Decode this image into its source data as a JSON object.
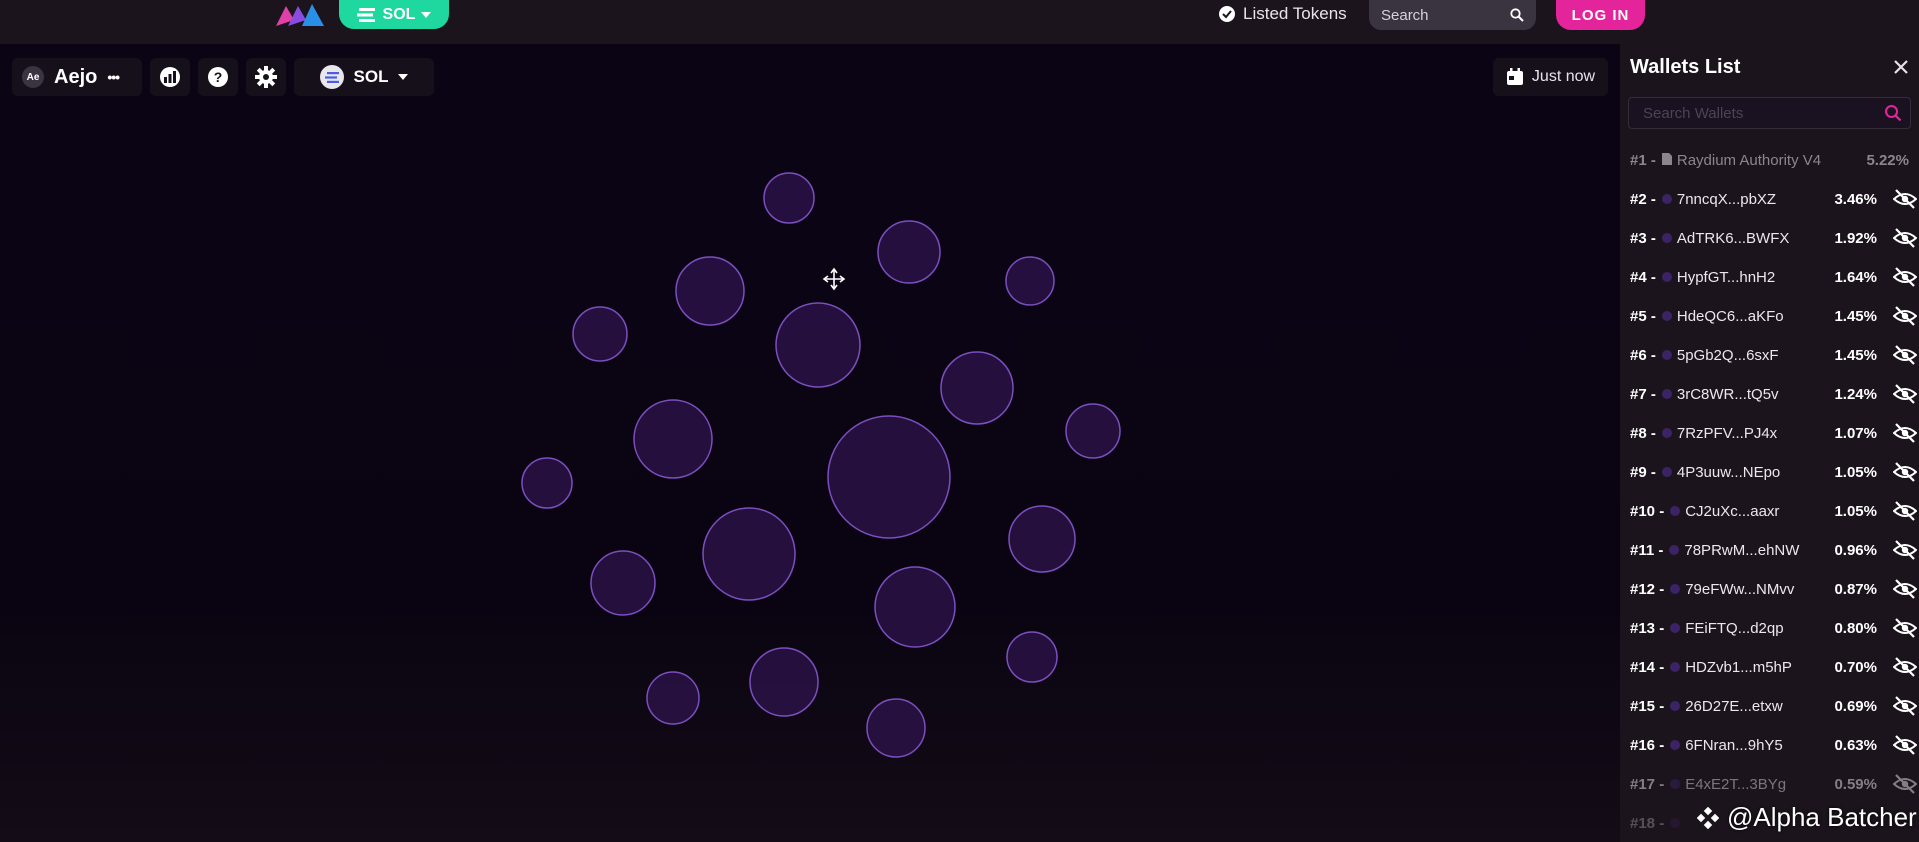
{
  "header": {
    "chain": "SOL",
    "listed_tokens": "Listed Tokens",
    "search_placeholder": "Search",
    "login": "LOG IN"
  },
  "toolbar": {
    "project_initials": "Ae",
    "project_name": "Aejo",
    "more": "•••",
    "currency": "SOL",
    "time": "Just now"
  },
  "wallets": {
    "title": "Wallets List",
    "search_placeholder": "Search Wallets",
    "items": [
      {
        "rank": "#1 -",
        "name": "Raydium Authority V4",
        "pct": "5.22%"
      },
      {
        "rank": "#2 -",
        "name": "7nncqX...pbXZ",
        "pct": "3.46%"
      },
      {
        "rank": "#3 -",
        "name": "AdTRK6...BWFX",
        "pct": "1.92%"
      },
      {
        "rank": "#4 -",
        "name": "HypfGT...hnH2",
        "pct": "1.64%"
      },
      {
        "rank": "#5 -",
        "name": "HdeQC6...aKFo",
        "pct": "1.45%"
      },
      {
        "rank": "#6 -",
        "name": "5pGb2Q...6sxF",
        "pct": "1.45%"
      },
      {
        "rank": "#7 -",
        "name": "3rC8WR...tQ5v",
        "pct": "1.24%"
      },
      {
        "rank": "#8 -",
        "name": "7RzPFV...PJ4x",
        "pct": "1.07%"
      },
      {
        "rank": "#9 -",
        "name": "4P3uuw...NEpo",
        "pct": "1.05%"
      },
      {
        "rank": "#10 -",
        "name": "CJ2uXc...aaxr",
        "pct": "1.05%"
      },
      {
        "rank": "#11 -",
        "name": "78PRwM...ehNW",
        "pct": "0.96%"
      },
      {
        "rank": "#12 -",
        "name": "79eFWw...NMvv",
        "pct": "0.87%"
      },
      {
        "rank": "#13 -",
        "name": "FEiFTQ...d2qp",
        "pct": "0.80%"
      },
      {
        "rank": "#14 -",
        "name": "HDZvb1...m5hP",
        "pct": "0.70%"
      },
      {
        "rank": "#15 -",
        "name": "26D27E...etxw",
        "pct": "0.69%"
      },
      {
        "rank": "#16 -",
        "name": "6FNran...9hY5",
        "pct": "0.63%"
      },
      {
        "rank": "#17 -",
        "name": "E4xE2T...3BYg",
        "pct": "0.59%"
      },
      {
        "rank": "#18 -",
        "name": "",
        "pct": ""
      }
    ]
  },
  "watermark": "@Alpha Batcher",
  "colors": {
    "accent_pink": "#e4249b",
    "chain_green": "#1fd8a0",
    "bubble_stroke": "#7b4fc0",
    "bubble_fill": "#2a1245"
  }
}
